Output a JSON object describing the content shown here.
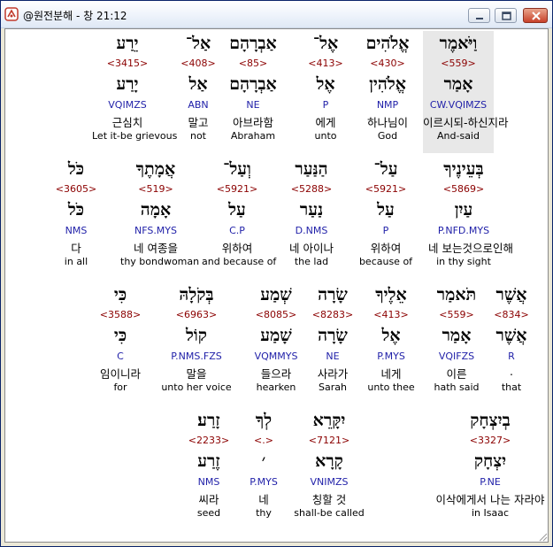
{
  "window": {
    "title": "@원전분해 - 창 21:12"
  },
  "colors": {
    "strong": "#8b0000",
    "morph": "#1f1fa8",
    "text": "#000000",
    "selected_bg": "#e8e8e8"
  },
  "rows": [
    {
      "words": [
        {
          "heb": "וַיֹּאמֶר",
          "strong": "<559>",
          "lemma": "אָמַר",
          "morph": "CW.VQIMZS",
          "kor": "이르시되-하신지라",
          "eng": "And-said",
          "selected": true
        },
        {
          "heb": "אֱלֹהִים",
          "strong": "<430>",
          "lemma": "אֱלֹהִין",
          "morph": "NMP",
          "kor": "하나님이",
          "eng": "God"
        },
        {
          "heb": "אֶל־",
          "strong": "<413>",
          "lemma": "אֶל",
          "morph": "P",
          "kor": "에게",
          "eng": "unto"
        },
        {
          "heb": "אַבְרָהָם",
          "strong": "<85>",
          "lemma": "אַבְרָהָם",
          "morph": "NE",
          "kor": "아브라함",
          "eng": "Abraham"
        },
        {
          "heb": "אַל־",
          "strong": "<408>",
          "lemma": "אַל",
          "morph": "ABN",
          "kor": "말고",
          "eng": "not"
        },
        {
          "heb": "יֵרַע",
          "strong": "<3415>",
          "lemma": "יָרַע",
          "morph": "VQIMZS",
          "kor": "근심치",
          "eng": "Let it-be grievous"
        }
      ]
    },
    {
      "words": [
        {
          "heb": "בְּעֵינֶיךָ",
          "strong": "<5869>",
          "lemma": "עַיִן",
          "morph": "P.NFD.MYS",
          "kor": "네 보는것으로인해",
          "eng": "in thy sight"
        },
        {
          "heb": "עַל־",
          "strong": "<5921>",
          "lemma": "עַל",
          "morph": "P",
          "kor": "위하여",
          "eng": "because of"
        },
        {
          "heb": "הַנַּעַר",
          "strong": "<5288>",
          "lemma": "נַעַר",
          "morph": "D.NMS",
          "kor": "네 아이나",
          "eng": "the lad"
        },
        {
          "heb": "וְעַל־",
          "strong": "<5921>",
          "lemma": "עַל",
          "morph": "C.P",
          "kor": "위하여",
          "eng": "and because of"
        },
        {
          "heb": "אֲמָתֶךָ",
          "strong": "<519>",
          "lemma": "אָמָה",
          "morph": "NFS.MYS",
          "kor": "네 여종을",
          "eng": "thy bondwoman"
        },
        {
          "heb": "כֹּל",
          "strong": "<3605>",
          "lemma": "כֹּל",
          "morph": "NMS",
          "kor": "다",
          "eng": "in all"
        }
      ]
    },
    {
      "words": [
        {
          "heb": "אֲשֶׁר",
          "strong": "<834>",
          "lemma": "אֲשֶׁר",
          "morph": "R",
          "kor": ".",
          "eng": "that"
        },
        {
          "heb": "תֹּאמַר",
          "strong": "<559>",
          "lemma": "אָמַר",
          "morph": "VQIFZS",
          "kor": "이른",
          "eng": "hath said"
        },
        {
          "heb": "אֵלֶיךָ",
          "strong": "<413>",
          "lemma": "אֶל",
          "morph": "P.MYS",
          "kor": "네게",
          "eng": "unto thee"
        },
        {
          "heb": "שָׂרָה",
          "strong": "<8283>",
          "lemma": "שָׂרָה",
          "morph": "NE",
          "kor": "사라가",
          "eng": "Sarah"
        },
        {
          "heb": "שְׁמַע",
          "strong": "<8085>",
          "lemma": "שָׁמַע",
          "morph": "VQMMYS",
          "kor": "들으라",
          "eng": "hearken"
        },
        {
          "heb": "בְּקֹלָהּ",
          "strong": "<6963>",
          "lemma": "קוֹל",
          "morph": "P.NMS.FZS",
          "kor": "말을",
          "eng": "unto her voice"
        },
        {
          "heb": "כִּי",
          "strong": "<3588>",
          "lemma": "כִּי",
          "morph": "C",
          "kor": "임이니라",
          "eng": "for"
        }
      ]
    },
    {
      "words": [
        {
          "heb": "בְיִצְחָק",
          "strong": "<3327>",
          "lemma": "יִצְחָק",
          "morph": "P.NE",
          "kor": "이삭에게서 나는 자라야",
          "eng": "in Isaac"
        },
        {
          "heb": "יִקָּרֵא",
          "strong": "<7121>",
          "lemma": "קָרָא",
          "morph": "VNIMZS",
          "kor": "칭할 것",
          "eng": "shall-be called"
        },
        {
          "heb": "לְךָ",
          "strong": "<.>",
          "lemma": "׳",
          "morph": "P.MYS",
          "kor": "네",
          "eng": "thy"
        },
        {
          "heb": "זָרַע׃",
          "strong": "<2233>",
          "lemma": "זֶרַע",
          "morph": "NMS",
          "kor": "씨라",
          "eng": "seed"
        }
      ]
    }
  ]
}
